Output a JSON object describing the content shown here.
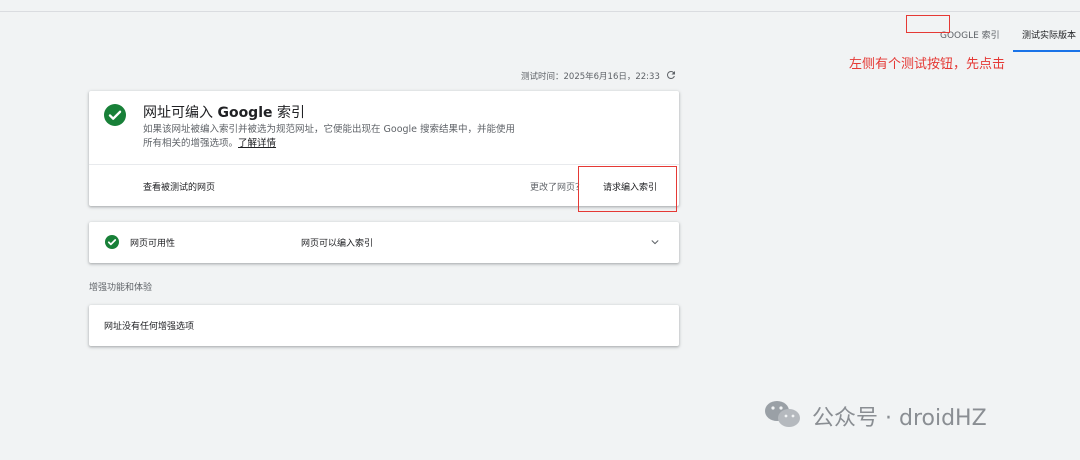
{
  "header": {
    "tabs": [
      {
        "label": "GOOGLE 索引",
        "active": false
      },
      {
        "label": "测试实际版本",
        "active": true
      }
    ]
  },
  "annotation": {
    "text": "左侧有个测试按钮，先点击",
    "color": "#e53935"
  },
  "test": {
    "time_label": "测试时间：2025年6月16日，22:33"
  },
  "status_card": {
    "title_prefix": "网址可编入",
    "title_brand": "Google",
    "title_suffix": "索引",
    "description": "如果该网址被编入索引并被选为规范网址，它便能出现在 Google 搜索结果中，并能使用所有相关的增强选项。",
    "learn_more": "了解详情",
    "view_tested_page": "查看被测试的网页",
    "page_changed": "更改了网页？",
    "request_indexing": "请求编入索引"
  },
  "availability": {
    "label": "网页可用性",
    "value": "网页可以编入索引"
  },
  "enhancements": {
    "section_label": "增强功能和体验",
    "empty_text": "网址没有任何增强选项"
  },
  "watermark": {
    "text": "公众号 · droidHZ"
  },
  "colors": {
    "success": "#188038",
    "accent": "#1a73e8",
    "highlight": "#e53935"
  }
}
